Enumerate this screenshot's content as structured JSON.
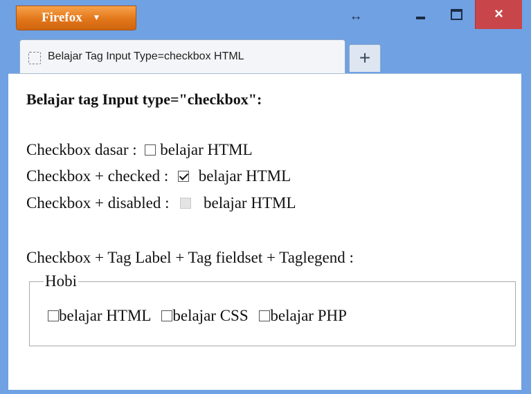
{
  "browser": {
    "menu_label": "Firefox",
    "menu_caret": "▼",
    "resize_glyph": "↔",
    "close_glyph": "×",
    "tab_title": "Belajar Tag Input Type=checkbox HTML",
    "new_tab_glyph": "+"
  },
  "page": {
    "heading": "Belajar tag Input type=\"checkbox\":",
    "rows": [
      {
        "prefix": "Checkbox dasar :",
        "label": "belajar HTML",
        "state": "unchecked"
      },
      {
        "prefix": "Checkbox + checked :",
        "label": "belajar HTML",
        "state": "checked"
      },
      {
        "prefix": "Checkbox + disabled :",
        "label": "belajar HTML",
        "state": "disabled"
      }
    ],
    "fieldset_caption": "Checkbox + Tag Label + Tag fieldset + Taglegend :",
    "fieldset": {
      "legend": "Hobi",
      "options": [
        "belajar HTML",
        "belajar CSS",
        "belajar PHP"
      ]
    }
  }
}
